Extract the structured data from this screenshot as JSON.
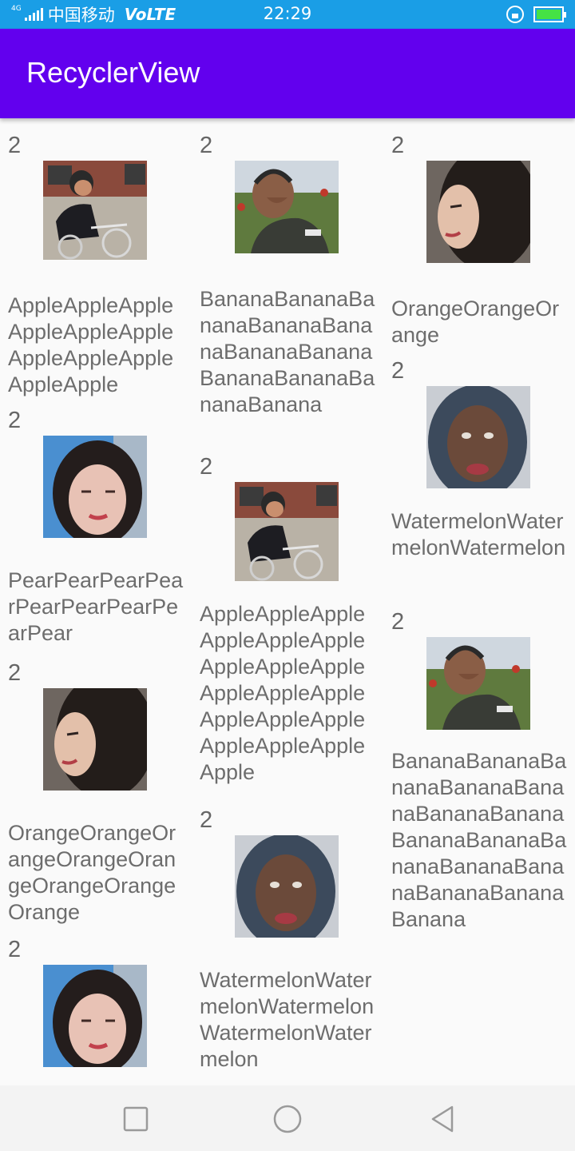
{
  "status_bar": {
    "network": "4G",
    "carrier": "中国移动",
    "volte": "VoLTE",
    "time": "22:29",
    "battery_color": "#45e245"
  },
  "app_bar": {
    "title": "RecyclerView",
    "color": "#6200ee"
  },
  "items": [
    {
      "number": "2",
      "name": "AppleAppleAppleAppleAppleAppleAppleAppleAppleAppleApple",
      "image": "boy-on-bicycle photo"
    },
    {
      "number": "2",
      "name": "PearPearPearPearPearPearPearPearPear",
      "image": "girl-selfie photo"
    },
    {
      "number": "2",
      "name": "OrangeOrangeOrangeOrangeOrangeOrangeOrangeOrange",
      "image": "girl-profile photo"
    },
    {
      "number": "2",
      "name": "",
      "image": "girl-selfie photo"
    },
    {
      "number": "2",
      "name": "BananaBananaBananaBananaBananaBananaBananaBananaBananaBananaBanana",
      "image": "man-covering-face photo"
    },
    {
      "number": "2",
      "name": "AppleAppleAppleAppleAppleAppleAppleAppleAppleAppleAppleAppleAppleAppleAppleAppleAppleAppleApple",
      "image": "boy-on-bicycle photo"
    },
    {
      "number": "2",
      "name": "WatermelonWatermelonWatermelonWatermelonWatermelon",
      "image": "man-in-hood photo"
    },
    {
      "number": "2",
      "name": "OrangeOrangeOrange",
      "image": "girl-profile photo"
    },
    {
      "number": "2",
      "name": "WatermelonWatermelonWatermelon",
      "image": "man-in-hood photo"
    },
    {
      "number": "2",
      "name": "BananaBananaBananaBananaBananaBananaBananaBananaBananaBananaBananaBananaBananaBananaBanana",
      "image": "man-covering-face photo"
    }
  ],
  "nav_bar": {
    "icons": [
      "square-recent-icon",
      "circle-home-icon",
      "triangle-back-icon"
    ]
  }
}
